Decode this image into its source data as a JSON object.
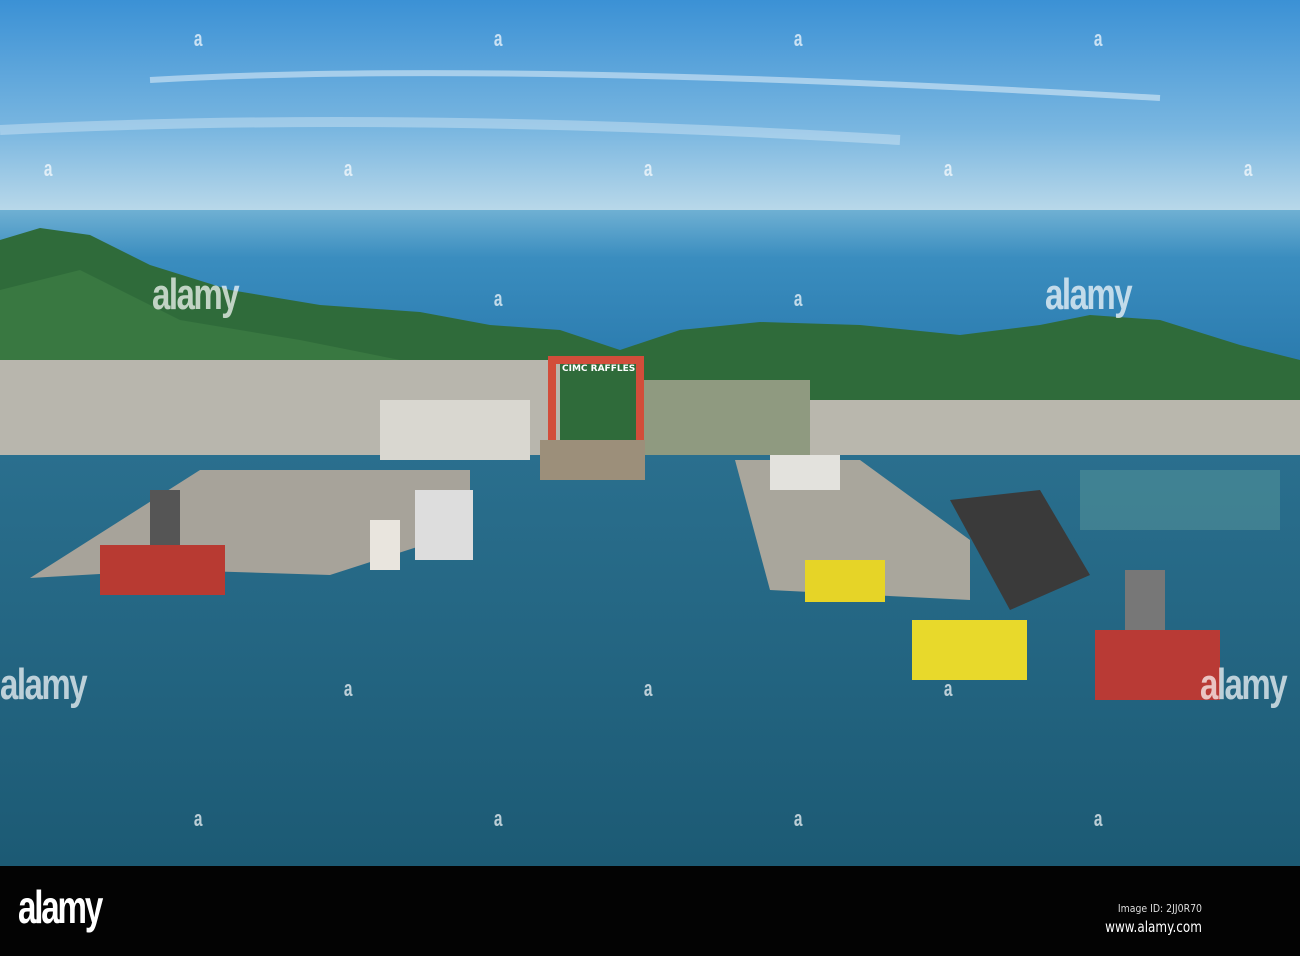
{
  "photo": {
    "description_label": "Aerial view of shipyard",
    "gantry_sign": "CIMC RAFFLES",
    "colors": {
      "sky_top": "#3d93d6",
      "sky_bottom": "#b9d9ec",
      "sea_far": "#3c8fc0",
      "sea_near": "#1c5f7c",
      "hills": "#2f6b3a"
    }
  },
  "watermark": {
    "text": "alamy",
    "small": "a"
  },
  "footer": {
    "logo": "alamy",
    "image_id": "Image ID: 2JJ0R70",
    "url": "www.alamy.com"
  }
}
